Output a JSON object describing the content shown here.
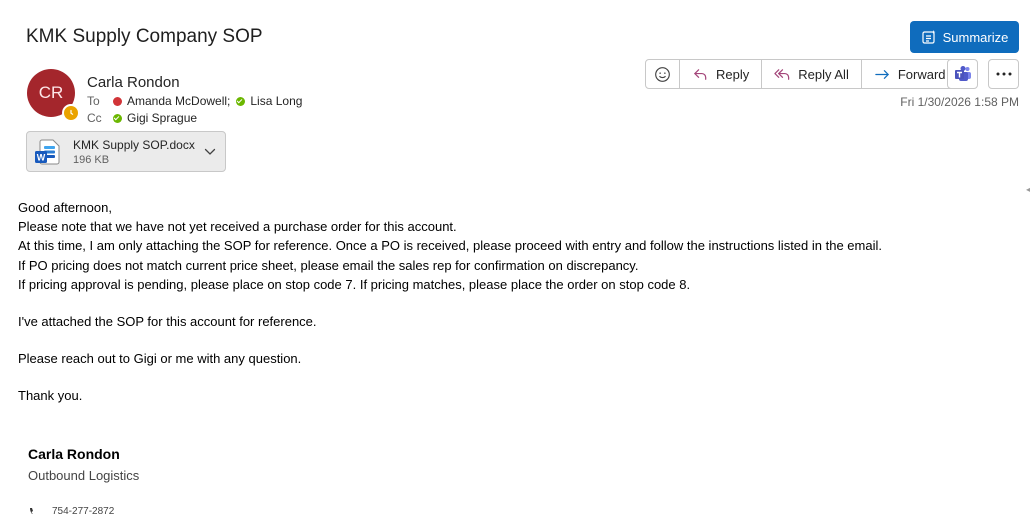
{
  "email": {
    "subject": "KMK Supply Company SOP",
    "sender": {
      "initials": "CR",
      "name": "Carla Rondon",
      "avatar_color": "#a4262c",
      "presence": "away"
    },
    "to_label": "To",
    "cc_label": "Cc",
    "to": [
      {
        "name": "Amanda McDowell;",
        "presence": "busy"
      },
      {
        "name": "Lisa Long",
        "presence": "available"
      }
    ],
    "cc": [
      {
        "name": "Gigi Sprague",
        "presence": "available"
      }
    ],
    "date": "Fri 1/30/2026 1:58 PM",
    "attachment": {
      "name": "KMK Supply SOP.docx",
      "size": "196 KB",
      "icon": "word-doc-icon"
    },
    "body": [
      "Good afternoon,",
      "Please note that we have not yet received a purchase order for this account.",
      "At this time, I am only attaching the SOP for reference. Once a PO is received, please proceed with entry and follow the instructions listed in the email.",
      "If PO pricing does not match current price sheet, please email the sales rep for confirmation on discrepancy.",
      "If pricing approval is pending, please place on stop code 7. If pricing matches, please place the order on stop code 8.",
      "I've attached the SOP for this account for reference.",
      "Please reach out to Gigi or me with any question.",
      "Thank you."
    ],
    "signature": {
      "name": "Carla Rondon",
      "title": "Outbound Logistics",
      "phone": "754-277-2872"
    }
  },
  "toolbar": {
    "summarize_label": "Summarize",
    "reply_label": "Reply",
    "reply_all_label": "Reply All",
    "forward_label": "Forward",
    "accent_color": "#0f6cbd"
  }
}
